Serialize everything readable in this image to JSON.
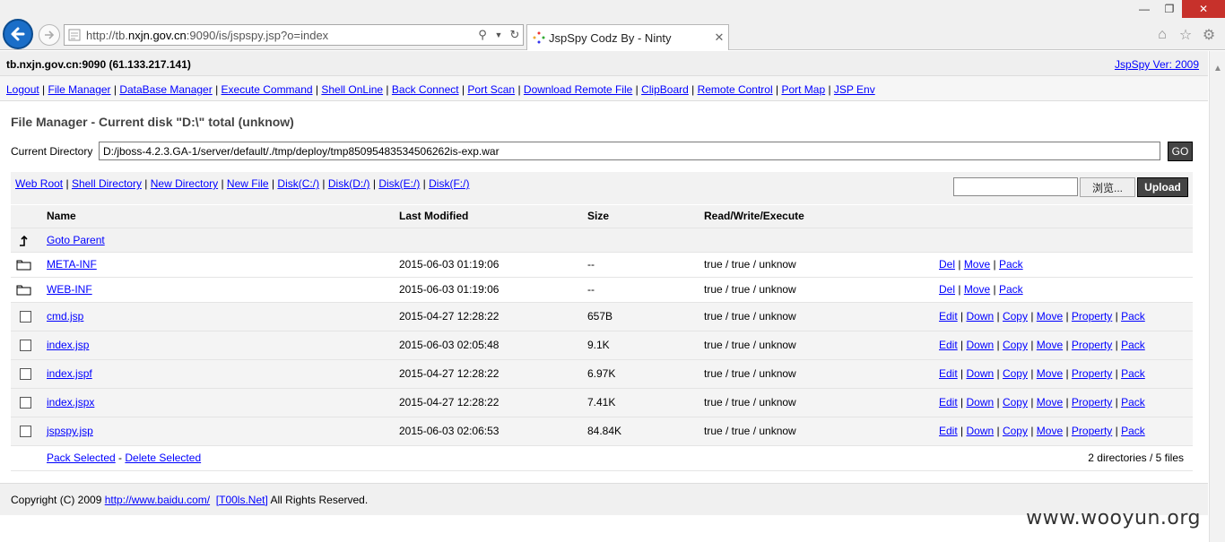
{
  "browser": {
    "address_prefix": "http://tb.",
    "address_domain": "nxjn.gov.cn",
    "address_suffix": ":9090/is/jspspy.jsp?o=index",
    "tab_title": "JspSpy Codz By - Ninty"
  },
  "header": {
    "host": "tb.nxjn.gov.cn:9090 (61.133.217.141)",
    "version": "JspSpy Ver: 2009"
  },
  "nav": [
    "Logout",
    "File Manager",
    "DataBase Manager",
    "Execute Command",
    "Shell OnLine",
    "Back Connect",
    "Port Scan",
    "Download Remote File",
    "ClipBoard",
    "Remote Control",
    "Port Map",
    "JSP Env"
  ],
  "file_manager": {
    "title": "File Manager - Current disk \"D:\\\" total (unknow)",
    "current_dir_label": "Current Directory",
    "current_dir_value": "D:/jboss-4.2.3.GA-1/server/default/./tmp/deploy/tmp85095483534506262is-exp.war",
    "go_label": "GO",
    "quick_links": [
      "Web Root",
      "Shell Directory",
      "New Directory",
      "New File",
      "Disk(C:/)",
      "Disk(D:/)",
      "Disk(E:/)",
      "Disk(F:/)"
    ],
    "browse_label": "浏览...",
    "upload_label": "Upload",
    "columns": [
      "Name",
      "Last Modified",
      "Size",
      "Read/Write/Execute"
    ],
    "goto_parent": "Goto Parent",
    "directories": [
      {
        "name": "META-INF",
        "modified": "2015-06-03 01:19:06",
        "size": "--",
        "rwx": "true / true / unknow"
      },
      {
        "name": "WEB-INF",
        "modified": "2015-06-03 01:19:06",
        "size": "--",
        "rwx": "true / true / unknow"
      }
    ],
    "dir_actions": [
      "Del",
      "Move",
      "Pack"
    ],
    "files": [
      {
        "name": "cmd.jsp",
        "modified": "2015-04-27 12:28:22",
        "size": "657B",
        "rwx": "true / true / unknow"
      },
      {
        "name": "index.jsp",
        "modified": "2015-06-03 02:05:48",
        "size": "9.1K",
        "rwx": "true / true / unknow"
      },
      {
        "name": "index.jspf",
        "modified": "2015-04-27 12:28:22",
        "size": "6.97K",
        "rwx": "true / true / unknow"
      },
      {
        "name": "index.jspx",
        "modified": "2015-04-27 12:28:22",
        "size": "7.41K",
        "rwx": "true / true / unknow"
      },
      {
        "name": "jspspy.jsp",
        "modified": "2015-06-03 02:06:53",
        "size": "84.84K",
        "rwx": "true / true / unknow"
      }
    ],
    "file_actions": [
      "Edit",
      "Down",
      "Copy",
      "Move",
      "Property",
      "Pack"
    ],
    "pack_selected": "Pack Selected",
    "delete_selected": "Delete Selected",
    "summary": "2 directories / 5 files"
  },
  "footer": {
    "copyright_prefix": "Copyright (C) 2009 ",
    "link1": "http://www.baidu.com/",
    "link2": "[T00ls.Net]",
    "suffix": " All Rights Reserved."
  },
  "watermark": "www.wooyun.org"
}
